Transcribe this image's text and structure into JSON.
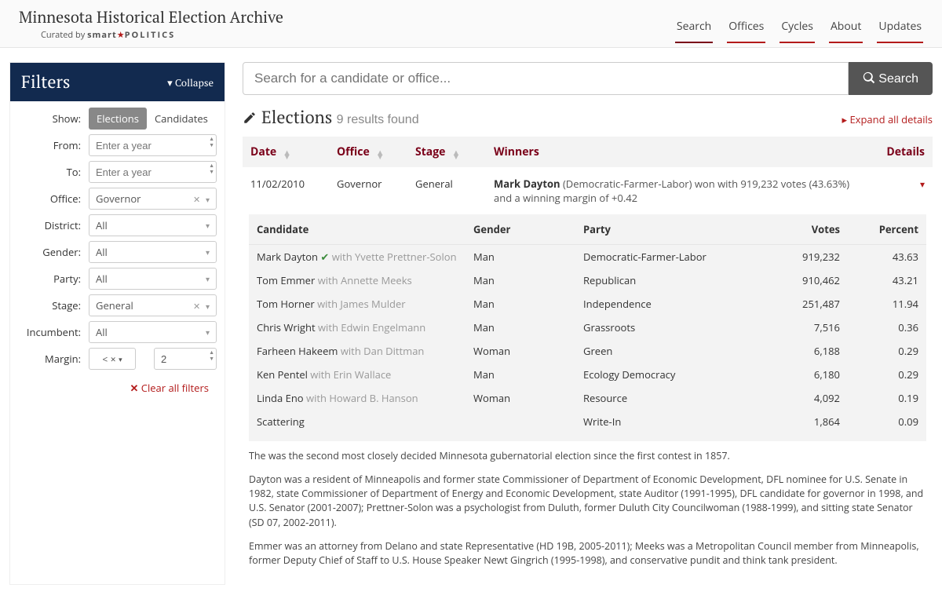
{
  "header": {
    "title": "Minnesota Historical Election Archive",
    "curated_prefix": "Curated by ",
    "brand_smart": "smart",
    "brand_politics": "POLITICS",
    "nav": [
      "Search",
      "Offices",
      "Cycles",
      "About",
      "Updates"
    ],
    "nav_active": "Search"
  },
  "filters": {
    "title": "Filters",
    "collapse": "Collapse",
    "labels": {
      "show": "Show:",
      "from": "From:",
      "to": "To:",
      "office": "Office:",
      "district": "District:",
      "gender": "Gender:",
      "party": "Party:",
      "stage": "Stage:",
      "incumbent": "Incumbent:",
      "margin": "Margin:"
    },
    "show_options": [
      "Elections",
      "Candidates"
    ],
    "show_active": "Elections",
    "from_placeholder": "Enter a year",
    "to_placeholder": "Enter a year",
    "office_value": "Governor",
    "district_value": "All",
    "gender_value": "All",
    "party_value": "All",
    "stage_value": "General",
    "incumbent_value": "All",
    "margin_op": "<",
    "margin_value": "2",
    "clear": "Clear all filters"
  },
  "search": {
    "placeholder": "Search for a candidate or office...",
    "button": "Search"
  },
  "results": {
    "title": "Elections",
    "count_text": "9 results found",
    "expand": "Expand all details",
    "columns": {
      "date": "Date",
      "office": "Office",
      "stage": "Stage",
      "winners": "Winners",
      "details": "Details"
    },
    "row": {
      "date": "11/02/2010",
      "office": "Governor",
      "stage": "General",
      "winner_name": "Mark Dayton",
      "winner_rest": " (Democratic-Farmer-Labor) won with 919,232 votes (43.63%) and a winning margin of +0.42"
    },
    "sub_columns": {
      "candidate": "Candidate",
      "gender": "Gender",
      "party": "Party",
      "votes": "Votes",
      "percent": "Percent"
    },
    "candidates": [
      {
        "name": "Mark Dayton",
        "winner": true,
        "running": "with Yvette Prettner-Solon",
        "gender": "Man",
        "party": "Democratic-Farmer-Labor",
        "votes": "919,232",
        "pct": "43.63"
      },
      {
        "name": "Tom Emmer",
        "running": "with Annette Meeks",
        "gender": "Man",
        "party": "Republican",
        "votes": "910,462",
        "pct": "43.21"
      },
      {
        "name": "Tom Horner",
        "running": "with James Mulder",
        "gender": "Man",
        "party": "Independence",
        "votes": "251,487",
        "pct": "11.94"
      },
      {
        "name": "Chris Wright",
        "running": "with Edwin Engelmann",
        "gender": "Man",
        "party": "Grassroots",
        "votes": "7,516",
        "pct": "0.36"
      },
      {
        "name": "Farheen Hakeem",
        "running": "with Dan Dittman",
        "gender": "Woman",
        "party": "Green",
        "votes": "6,188",
        "pct": "0.29"
      },
      {
        "name": "Ken Pentel",
        "running": "with Erin Wallace",
        "gender": "Man",
        "party": "Ecology Democracy",
        "votes": "6,180",
        "pct": "0.29"
      },
      {
        "name": "Linda Eno",
        "running": "with Howard B. Hanson",
        "gender": "Woman",
        "party": "Resource",
        "votes": "4,092",
        "pct": "0.19"
      },
      {
        "name": "Scattering",
        "running": "",
        "gender": "",
        "party": "Write-In",
        "votes": "1,864",
        "pct": "0.09"
      }
    ],
    "notes": [
      "The was the second most closely decided Minnesota gubernatorial election since the first contest in 1857.",
      "Dayton was a resident of Minneapolis and former state Commissioner of Department of Economic Development, DFL nominee for U.S. Senate in 1982, state Commissioner of Department of Energy and Economic Development, state Auditor (1991-1995), DFL candidate for governor in 1998, and U.S. Senator (2001-2007); Prettner-Solon was a psychologist from Duluth, former Duluth City Councilwoman (1988-1999), and sitting state Senator (SD 07, 2002-2011).",
      "Emmer was an attorney from Delano and state Representative (HD 19B, 2005-2011); Meeks was a Metropolitan Council member from Minneapolis, former Deputy Chief of Staff to U.S. House Speaker Newt Gingrich (1995-1998), and conservative pundit and think tank president."
    ]
  }
}
